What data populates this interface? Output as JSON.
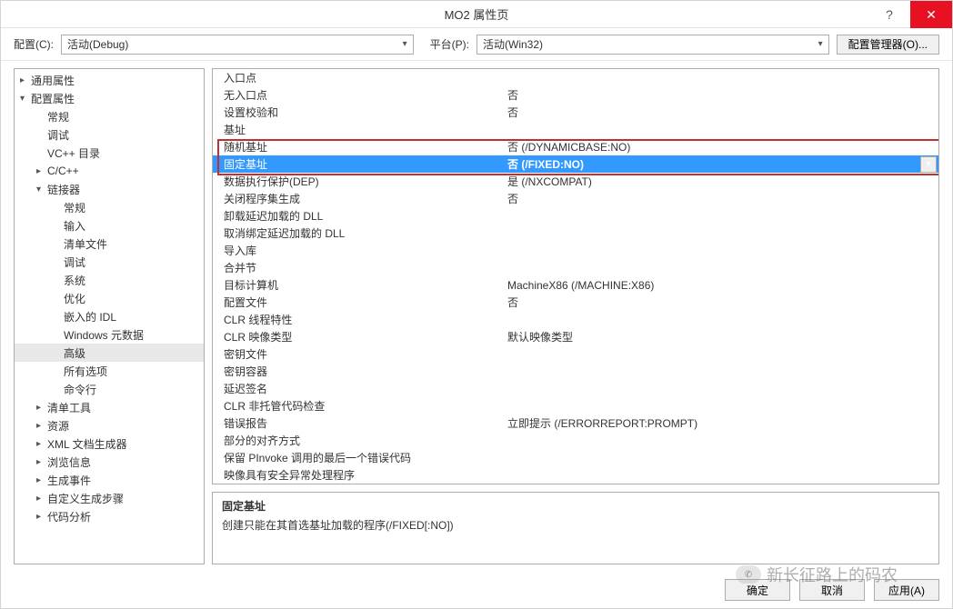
{
  "title": "MO2 属性页",
  "titlebar": {
    "help": "?",
    "close": "✕"
  },
  "config": {
    "config_label": "配置(C):",
    "config_value": "活动(Debug)",
    "platform_label": "平台(P):",
    "platform_value": "活动(Win32)",
    "manager_btn": "配置管理器(O)..."
  },
  "tree": [
    {
      "label": "通用属性",
      "depth": 0,
      "arrow": "collapsed"
    },
    {
      "label": "配置属性",
      "depth": 0,
      "arrow": "expanded"
    },
    {
      "label": "常规",
      "depth": 1,
      "arrow": "none"
    },
    {
      "label": "调试",
      "depth": 1,
      "arrow": "none"
    },
    {
      "label": "VC++ 目录",
      "depth": 1,
      "arrow": "none"
    },
    {
      "label": "C/C++",
      "depth": 1,
      "arrow": "collapsed"
    },
    {
      "label": "链接器",
      "depth": 1,
      "arrow": "expanded"
    },
    {
      "label": "常规",
      "depth": 2,
      "arrow": "none"
    },
    {
      "label": "输入",
      "depth": 2,
      "arrow": "none"
    },
    {
      "label": "清单文件",
      "depth": 2,
      "arrow": "none"
    },
    {
      "label": "调试",
      "depth": 2,
      "arrow": "none"
    },
    {
      "label": "系统",
      "depth": 2,
      "arrow": "none"
    },
    {
      "label": "优化",
      "depth": 2,
      "arrow": "none"
    },
    {
      "label": "嵌入的 IDL",
      "depth": 2,
      "arrow": "none"
    },
    {
      "label": "Windows 元数据",
      "depth": 2,
      "arrow": "none"
    },
    {
      "label": "高级",
      "depth": 2,
      "arrow": "none",
      "selected": true
    },
    {
      "label": "所有选项",
      "depth": 2,
      "arrow": "none"
    },
    {
      "label": "命令行",
      "depth": 2,
      "arrow": "none"
    },
    {
      "label": "清单工具",
      "depth": 1,
      "arrow": "collapsed"
    },
    {
      "label": "资源",
      "depth": 1,
      "arrow": "collapsed"
    },
    {
      "label": "XML 文档生成器",
      "depth": 1,
      "arrow": "collapsed"
    },
    {
      "label": "浏览信息",
      "depth": 1,
      "arrow": "collapsed"
    },
    {
      "label": "生成事件",
      "depth": 1,
      "arrow": "collapsed"
    },
    {
      "label": "自定义生成步骤",
      "depth": 1,
      "arrow": "collapsed"
    },
    {
      "label": "代码分析",
      "depth": 1,
      "arrow": "collapsed"
    }
  ],
  "props": [
    {
      "label": "入口点",
      "value": ""
    },
    {
      "label": "无入口点",
      "value": "否"
    },
    {
      "label": "设置校验和",
      "value": "否"
    },
    {
      "label": "基址",
      "value": ""
    },
    {
      "label": "随机基址",
      "value": "否 (/DYNAMICBASE:NO)"
    },
    {
      "label": "固定基址",
      "value": "否 (/FIXED:NO)",
      "selected": true,
      "dropdown": true
    },
    {
      "label": "数据执行保护(DEP)",
      "value": "是 (/NXCOMPAT)"
    },
    {
      "label": "关闭程序集生成",
      "value": "否"
    },
    {
      "label": "卸载延迟加载的 DLL",
      "value": ""
    },
    {
      "label": "取消绑定延迟加载的 DLL",
      "value": ""
    },
    {
      "label": "导入库",
      "value": ""
    },
    {
      "label": "合并节",
      "value": ""
    },
    {
      "label": "目标计算机",
      "value": "MachineX86 (/MACHINE:X86)"
    },
    {
      "label": "配置文件",
      "value": "否"
    },
    {
      "label": "CLR 线程特性",
      "value": ""
    },
    {
      "label": "CLR 映像类型",
      "value": "默认映像类型"
    },
    {
      "label": "密钥文件",
      "value": ""
    },
    {
      "label": "密钥容器",
      "value": ""
    },
    {
      "label": "延迟签名",
      "value": ""
    },
    {
      "label": "CLR 非托管代码检查",
      "value": ""
    },
    {
      "label": "错误报告",
      "value": "立即提示 (/ERRORREPORT:PROMPT)"
    },
    {
      "label": "部分的对齐方式",
      "value": ""
    },
    {
      "label": "保留 PInvoke 调用的最后一个错误代码",
      "value": ""
    },
    {
      "label": "映像具有安全异常处理程序",
      "value": ""
    }
  ],
  "desc": {
    "title": "固定基址",
    "text": "创建只能在其首选基址加载的程序(/FIXED[:NO])"
  },
  "footer": {
    "ok": "确定",
    "cancel": "取消",
    "apply": "应用(A)"
  },
  "watermark": "新长征路上的码农"
}
